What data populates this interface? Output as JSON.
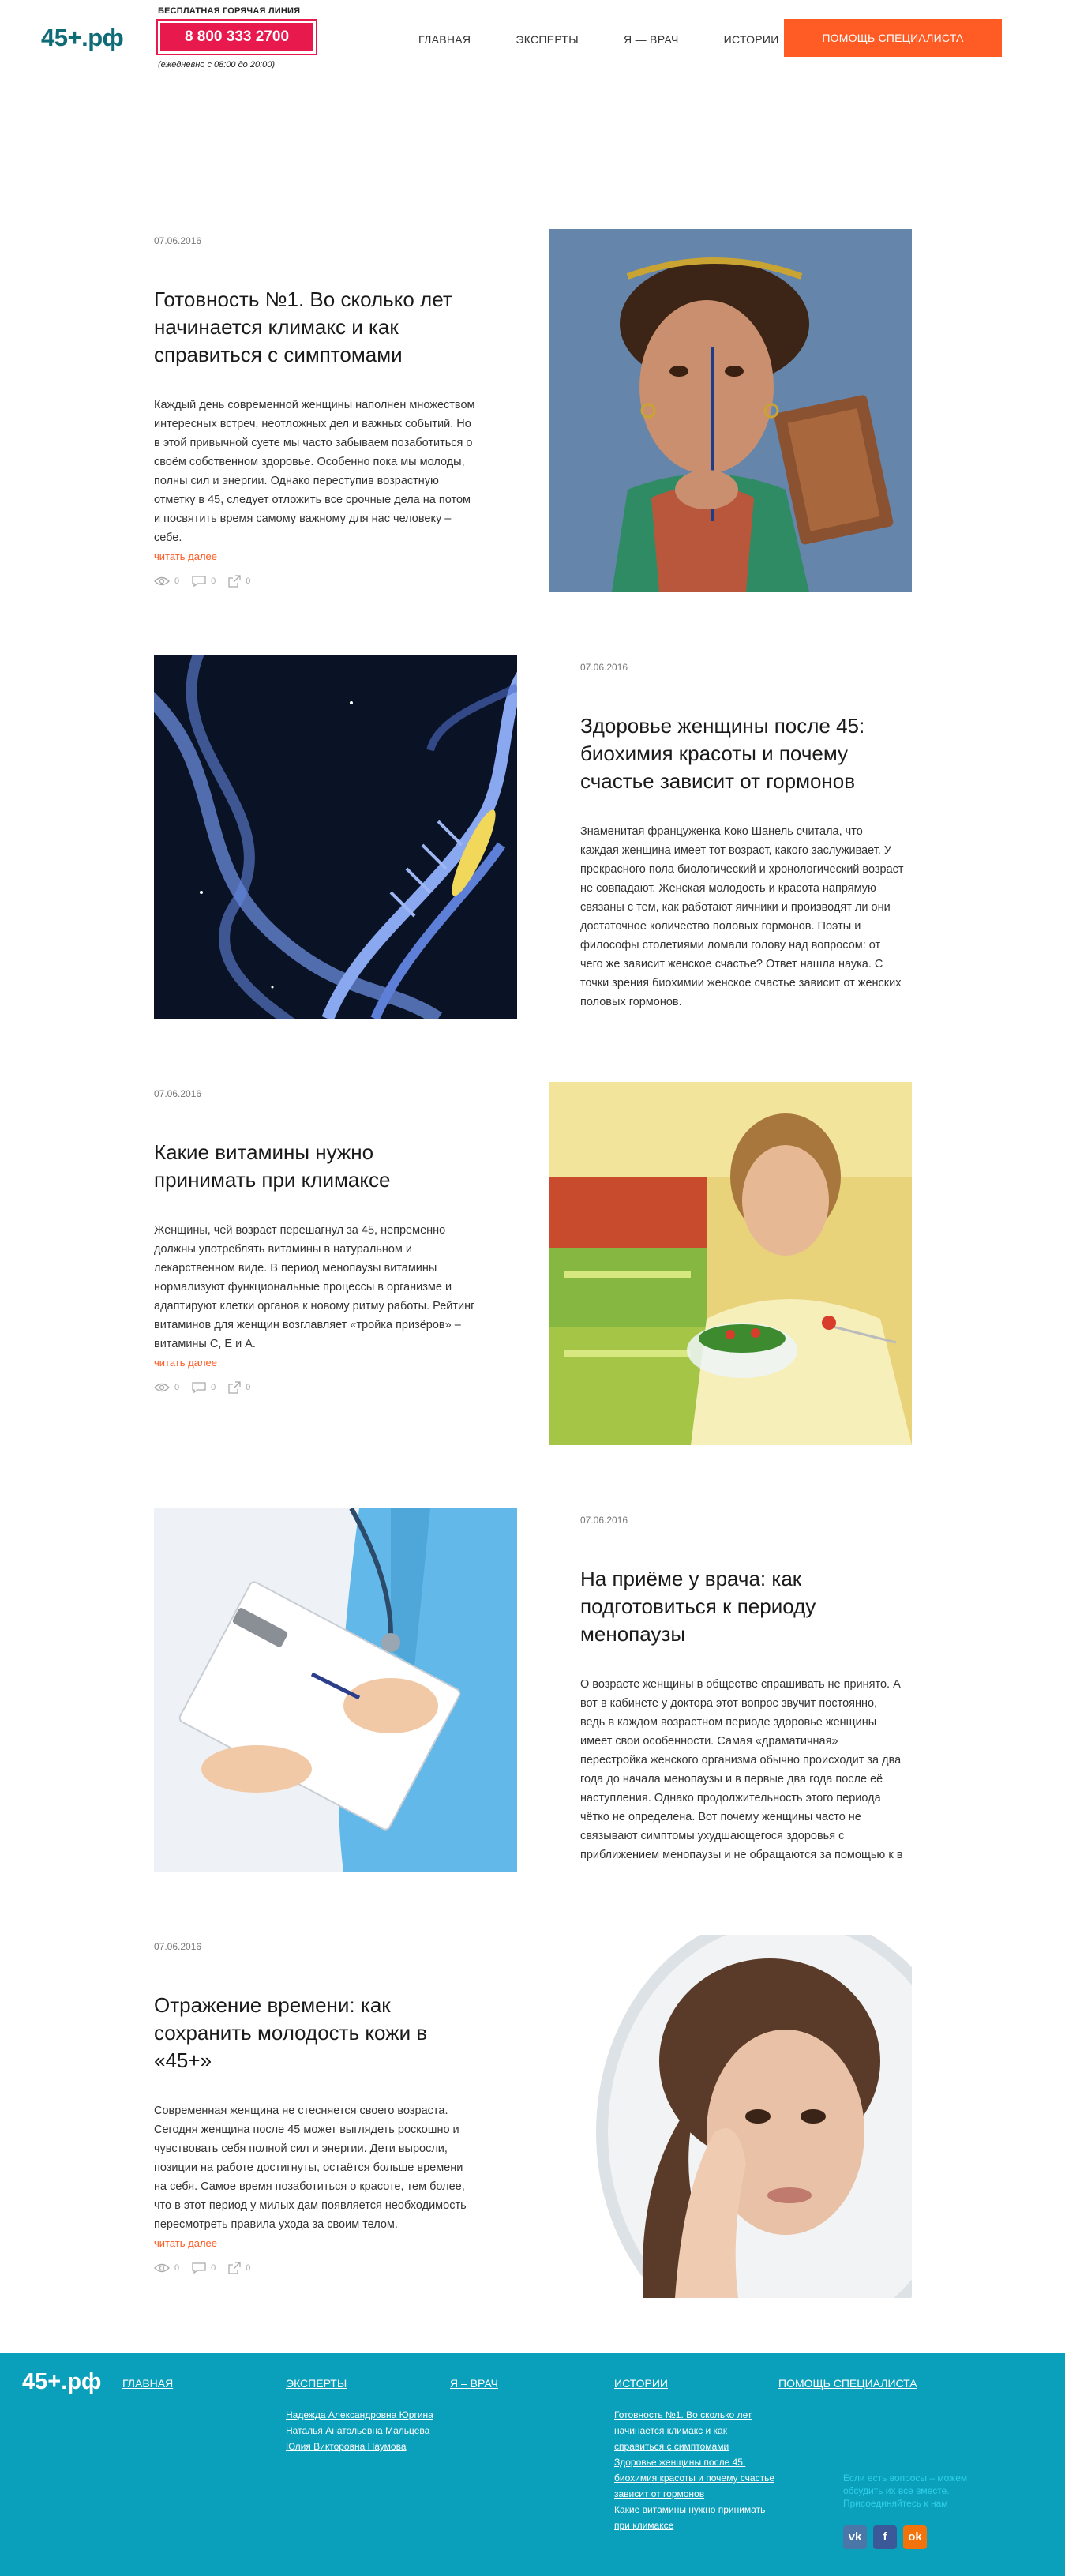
{
  "header": {
    "logo": "45+.рф",
    "hotline_label": "БЕСПЛАТНАЯ ГОРЯЧАЯ ЛИНИЯ",
    "hotline_phone": "8 800 333 2700",
    "hotline_hours": "(ежедневно с 08:00 до 20:00)",
    "nav": [
      "ГЛАВНАЯ",
      "ЭКСПЕРТЫ",
      "Я — ВРАЧ",
      "ИСТОРИИ"
    ],
    "cta": "ПОМОЩЬ СПЕЦИАЛИСТА"
  },
  "articles": [
    {
      "date": "07.06.2016",
      "title": "Готовность №1. Во сколько лет начинается климакс и как справиться с симптомами",
      "excerpt": "Каждый день современной женщины наполнен множеством интересных встреч, неотложных дел и важных событий. Но в этой привычной суете мы часто забываем позаботиться о своём собственном здоровье. Особенно пока мы молоды, полны сил и энергии. Однако переступив возрастную отметку в 45, следует отложить все срочные дела на потом и посвятить время самому важному для нас человеку – себе.",
      "more": "читать далее",
      "views": "0",
      "comments": "0",
      "shares": "0"
    },
    {
      "date": "07.06.2016",
      "title": "Здоровье женщины после 45: биохимия красоты и почему счастье зависит от гормонов",
      "excerpt": "Знаменитая француженка Коко Шанель считала, что каждая женщина имеет тот возраст, какого заслуживает. У прекрасного пола биологический и хронологический возраст не совпадают. Женская молодость и красота напрямую связаны с тем, как работают яичники и производят ли они достаточное количество половых гормонов. Поэты и философы столетиями ломали голову над вопросом: от чего же зависит женское счастье? Ответ нашла наука. С точки зрения биохимии женское счастье зависит от женских половых гормонов."
    },
    {
      "date": "07.06.2016",
      "title": "Какие витамины нужно принимать при климаксе",
      "excerpt": "Женщины, чей возраст перешагнул за 45, непременно должны употреблять витамины в натуральном и лекарственном виде. В период менопаузы витамины нормализуют функциональные процессы в организме и адаптируют клетки органов к новому ритму работы. Рейтинг витаминов для женщин возглавляет «тройка призёров» – витамины С, Е и А.",
      "more": "читать далее",
      "views": "0",
      "comments": "0",
      "shares": "0"
    },
    {
      "date": "07.06.2016",
      "title": "На приёме у врача: как подготовиться к периоду менопаузы",
      "excerpt": "О возрасте женщины в обществе спрашивать не принято. А вот в кабинете у доктора этот вопрос звучит постоянно, ведь в каждом возрастном периоде здоровье женщины имеет свои особенности. Самая «драматичная» перестройка женского организма обычно происходит за два года до начала менопаузы и в первые два года после её наступления. Однако продолжительность этого периода чётко не определена. Вот почему женщины часто не связывают симптомы ухудшающегося здоровья с приближением менопаузы и не обращаются за помощью к в"
    },
    {
      "date": "07.06.2016",
      "title": "Отражение времени: как сохранить молодость кожи в «45+»",
      "excerpt": "Современная женщина не стесняется своего возраста. Сегодня женщина после 45 может выглядеть роскошно и чувствовать себя полной сил и энергии. Дети выросли, позиции на работе достигнуты, остаётся больше времени на себя. Самое время позаботиться о красоте, тем более, что в этот период у милых дам появляется необходимость пересмотреть правила ухода за своим телом.",
      "more": "читать далее",
      "views": "0",
      "comments": "0",
      "shares": "0"
    }
  ],
  "footer": {
    "logo": "45+.рф",
    "home": "ГЛАВНАЯ",
    "experts": "ЭКСПЕРТЫ",
    "expert_links": [
      "Надежда Александровна Юргина",
      "Наталья Анатольевна Мальцева",
      "Юлия Викторовна Наумова"
    ],
    "doctor": "Я – ВРАЧ",
    "stories": "ИСТОРИИ",
    "story_links": [
      "Готовность №1. Во сколько лет",
      "начинается климакс и как",
      "справиться с симптомами",
      "Здоровье женщины после 45:",
      "биохимия красоты и почему счастье",
      "зависит от гормонов",
      "Какие витамины нужно принимать",
      "при климаксе"
    ],
    "help": "ПОМОЩЬ СПЕЦИАЛИСТА",
    "note": "Если есть вопросы – можем обсудить их все вместе. Присоединяйтесь к нам",
    "socials": [
      "vk",
      "f",
      "ok"
    ],
    "colors": {
      "vk": "#4a76a8",
      "fb": "#3b5998",
      "ok": "#f2720c"
    }
  }
}
